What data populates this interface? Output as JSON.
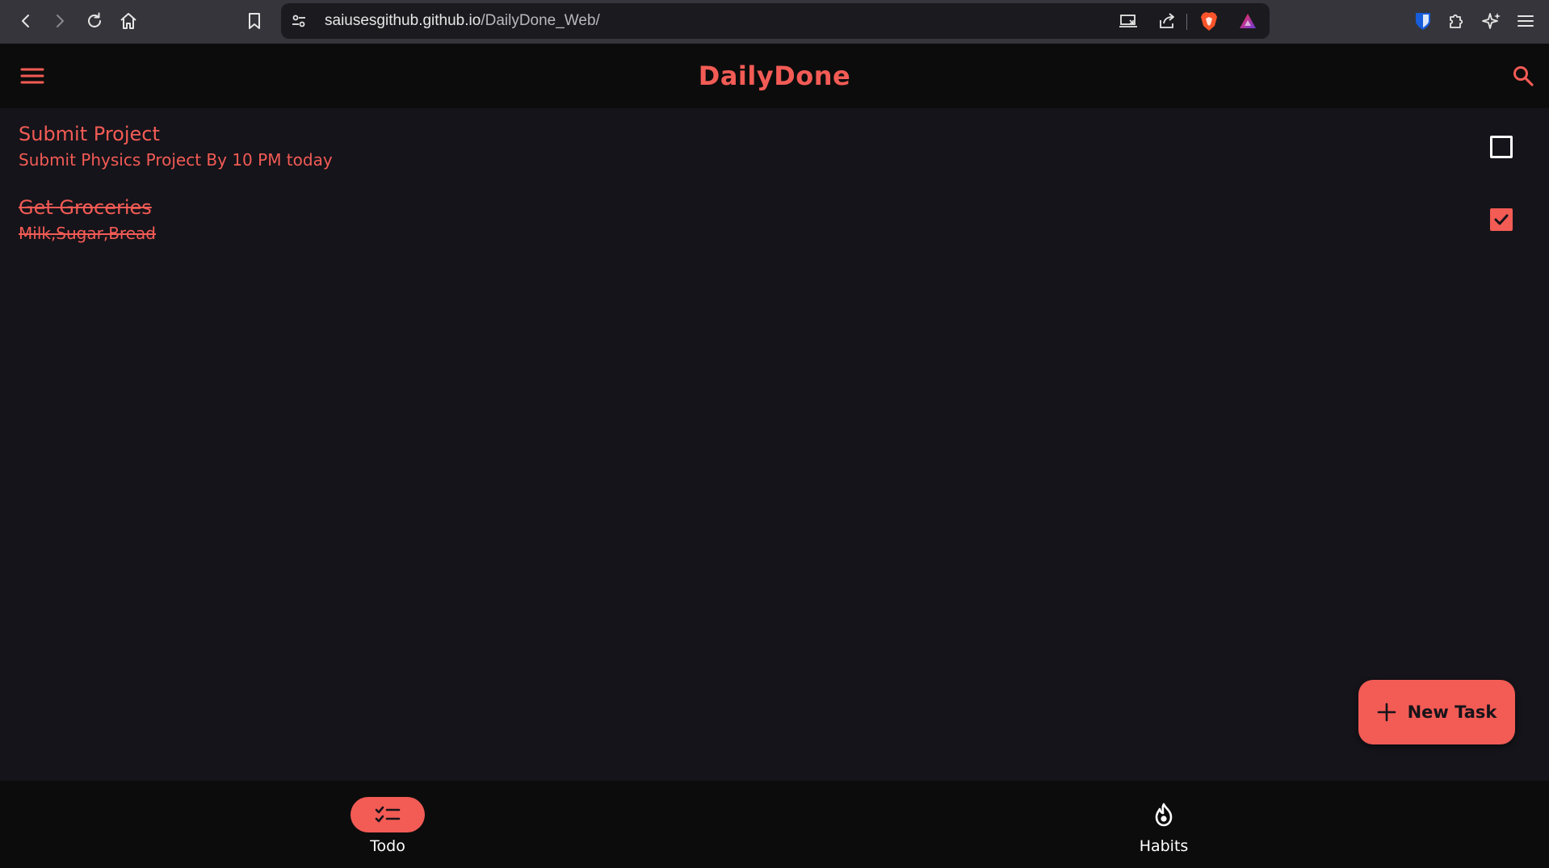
{
  "browser": {
    "url_host": "saiusesgithub.github.io",
    "url_path": "/DailyDone_Web/"
  },
  "app": {
    "title": "DailyDone",
    "accent_color": "#f35b55",
    "background_color": "#15141a"
  },
  "tasks": [
    {
      "title": "Submit Project",
      "description": "Submit Physics Project By 10 PM today",
      "completed": false
    },
    {
      "title": "Get Groceries",
      "description": "Milk,Sugar,Bread",
      "completed": true
    }
  ],
  "fab": {
    "label": "New Task",
    "icon": "plus-icon"
  },
  "bottom_nav": {
    "items": [
      {
        "label": "Todo",
        "icon": "checklist-icon",
        "active": true
      },
      {
        "label": "Habits",
        "icon": "flame-icon",
        "active": false
      }
    ]
  }
}
